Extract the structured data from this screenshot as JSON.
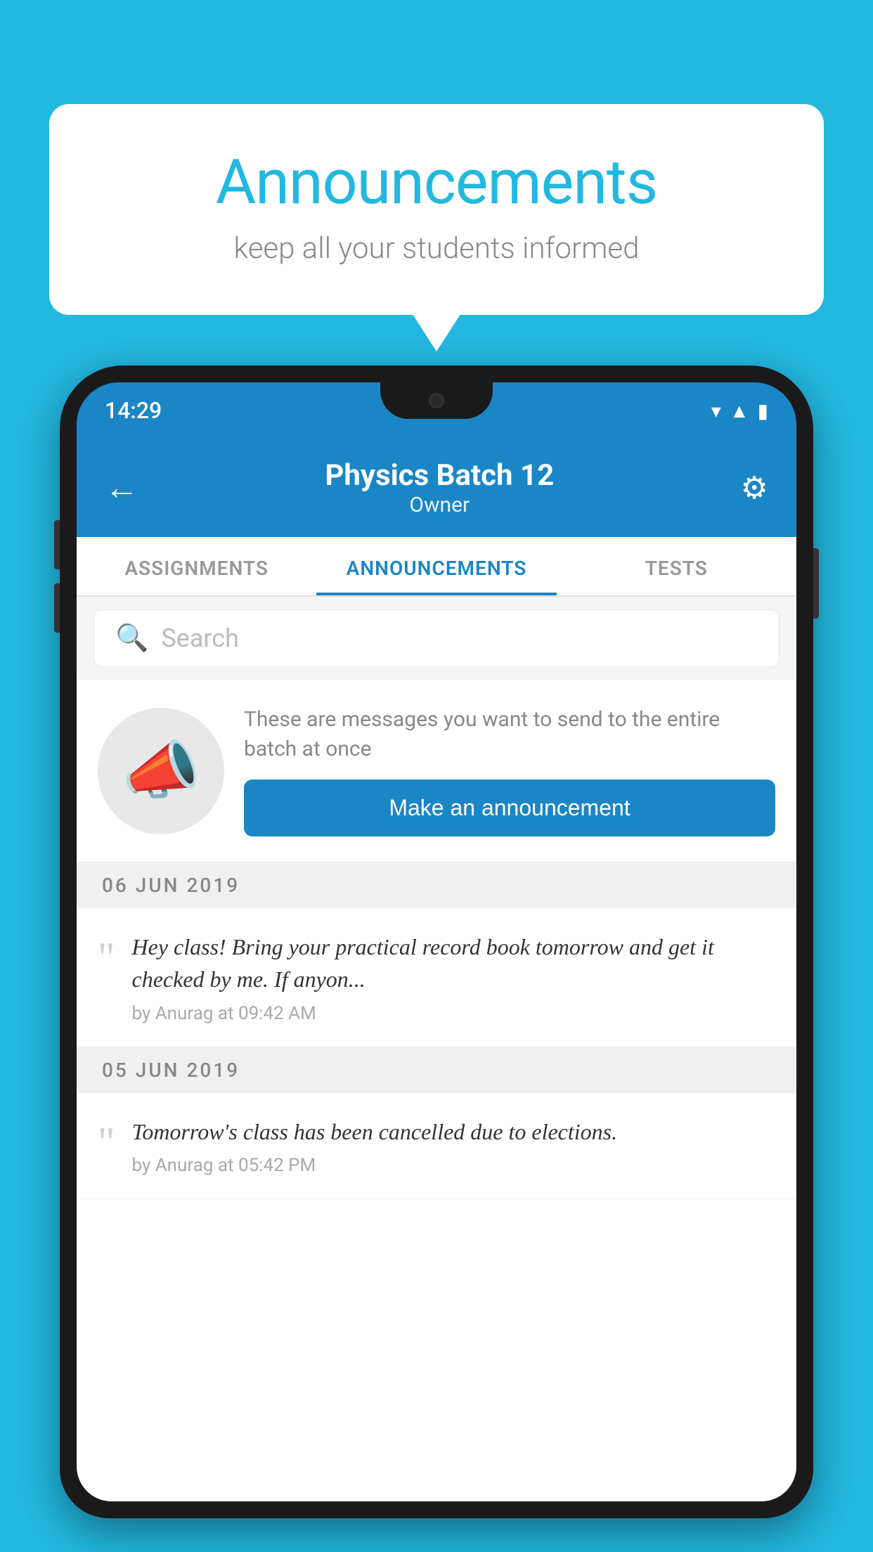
{
  "background_color": "#22b8e0",
  "speech_bubble": {
    "title": "Announcements",
    "subtitle": "keep all your students informed"
  },
  "phone": {
    "status_bar": {
      "time": "14:29"
    },
    "header": {
      "batch_name": "Physics Batch 12",
      "role": "Owner",
      "back_label": "←",
      "settings_label": "⚙"
    },
    "tabs": [
      {
        "label": "ASSIGNMENTS",
        "active": false
      },
      {
        "label": "ANNOUNCEMENTS",
        "active": true
      },
      {
        "label": "TESTS",
        "active": false
      }
    ],
    "search": {
      "placeholder": "Search"
    },
    "announcement_prompt": {
      "description": "These are messages you want to send to the entire batch at once",
      "button_label": "Make an announcement"
    },
    "announcements": [
      {
        "date": "06  JUN  2019",
        "text": "Hey class! Bring your practical record book tomorrow and get it checked by me. If anyon...",
        "meta": "by Anurag at 09:42 AM"
      },
      {
        "date": "05  JUN  2019",
        "text": "Tomorrow's class has been cancelled due to elections.",
        "meta": "by Anurag at 05:42 PM"
      }
    ]
  }
}
